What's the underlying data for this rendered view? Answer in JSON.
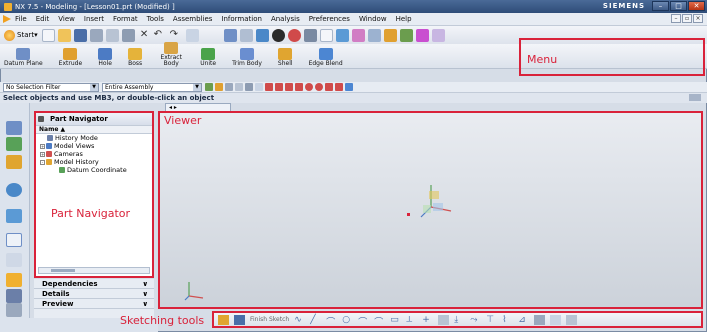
{
  "window": {
    "title": "NX 7.5 - Modeling - [Lesson01.prt (Modified) ]",
    "brand": "SIEMENS",
    "controls": [
      "minimize",
      "maximize",
      "close"
    ]
  },
  "menubar": {
    "items": [
      {
        "label": "File",
        "accel": "F"
      },
      {
        "label": "Edit",
        "accel": "E"
      },
      {
        "label": "View",
        "accel": "V"
      },
      {
        "label": "Insert",
        "accel": "I"
      },
      {
        "label": "Format",
        "accel": "F"
      },
      {
        "label": "Tools",
        "accel": "T"
      },
      {
        "label": "Assemblies",
        "accel": "A"
      },
      {
        "label": "Information",
        "accel": "I"
      },
      {
        "label": "Analysis",
        "accel": "l"
      },
      {
        "label": "Preferences",
        "accel": "P"
      },
      {
        "label": "Window",
        "accel": "o"
      },
      {
        "label": "Help",
        "accel": "H"
      }
    ]
  },
  "toolbar_standard": {
    "start_label": "Start"
  },
  "toolbar_features": {
    "commands": [
      {
        "label": "Datum Plane",
        "color": "#6f8fc6"
      },
      {
        "label": "Extrude",
        "color": "#e0a030"
      },
      {
        "label": "Hole",
        "color": "#4c7bc4"
      },
      {
        "label": "Boss",
        "color": "#e5b33a"
      },
      {
        "label": "Extract Body",
        "color": "#d9a445"
      },
      {
        "label": "Unite",
        "color": "#4aa34a"
      },
      {
        "label": "Trim Body",
        "color": "#6a8ed0"
      },
      {
        "label": "Shell",
        "color": "#e0a530"
      },
      {
        "label": "Edge Blend",
        "color": "#4c86d2"
      }
    ]
  },
  "annotations": {
    "menu": "Menu",
    "viewer": "Viewer",
    "part_navigator": "Part Navigator",
    "sketching_tools": "Sketching tools"
  },
  "selection": {
    "filter": "No Selection Filter",
    "scope": "Entire Assembly"
  },
  "cue_line": "Select objects and use MB3, or double-click an object",
  "part_navigator": {
    "title": "Part Navigator",
    "column": "Name",
    "tree": [
      {
        "label": "History Mode",
        "level": 0,
        "expander": "",
        "icon_color": "#6b7fa8"
      },
      {
        "label": "Model Views",
        "level": 0,
        "expander": "+",
        "icon_color": "#4c7bc4"
      },
      {
        "label": "Cameras",
        "level": 0,
        "expander": "+",
        "icon_color": "#d05050"
      },
      {
        "label": "Model History",
        "level": 0,
        "expander": "-",
        "icon_color": "#e0a530"
      },
      {
        "label": "Datum Coordinate",
        "level": 1,
        "expander": "",
        "icon_color": "#58a158"
      }
    ]
  },
  "panels": [
    {
      "label": "Dependencies"
    },
    {
      "label": "Details"
    },
    {
      "label": "Preview"
    }
  ],
  "sketchbar": {
    "finish_label": "Finish Sketch"
  },
  "colors": {
    "annotation_red": "#d9223a",
    "title_bar": "#2e4c78"
  }
}
